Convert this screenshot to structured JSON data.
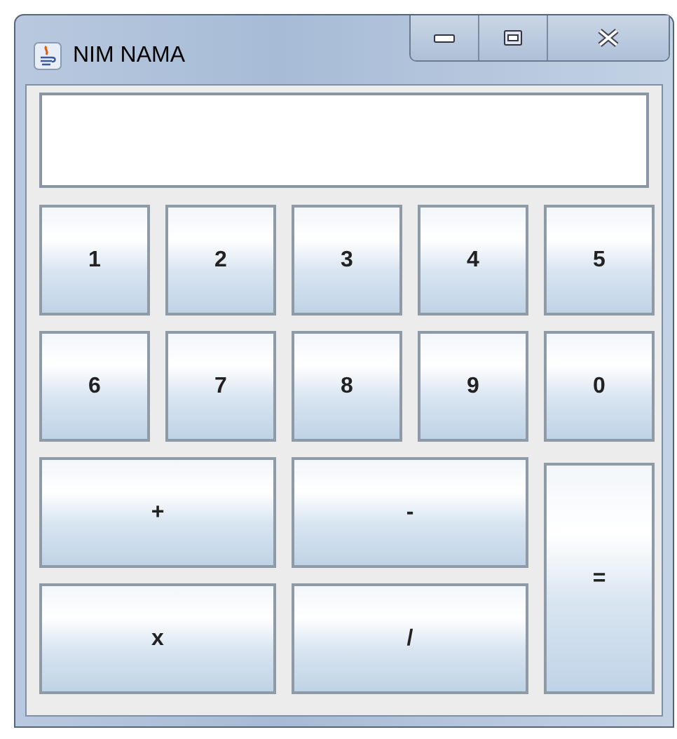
{
  "window": {
    "title": "NIM NAMA"
  },
  "keys": [
    {
      "label": "1",
      "kind": "key"
    },
    {
      "label": "2",
      "kind": "key"
    },
    {
      "label": "3",
      "kind": "key"
    },
    {
      "label": "4",
      "kind": "key"
    },
    {
      "label": "5",
      "kind": "key"
    },
    {
      "label": "6",
      "kind": "key"
    },
    {
      "label": "7",
      "kind": "key"
    },
    {
      "label": "8",
      "kind": "key"
    },
    {
      "label": "9",
      "kind": "key"
    },
    {
      "label": "0",
      "kind": "key"
    },
    {
      "label": "+",
      "kind": "wide"
    },
    {
      "label": "-",
      "kind": "wide"
    },
    {
      "label": "=",
      "kind": "tall"
    },
    {
      "label": "x",
      "kind": "wide"
    },
    {
      "label": "/",
      "kind": "wide"
    }
  ]
}
